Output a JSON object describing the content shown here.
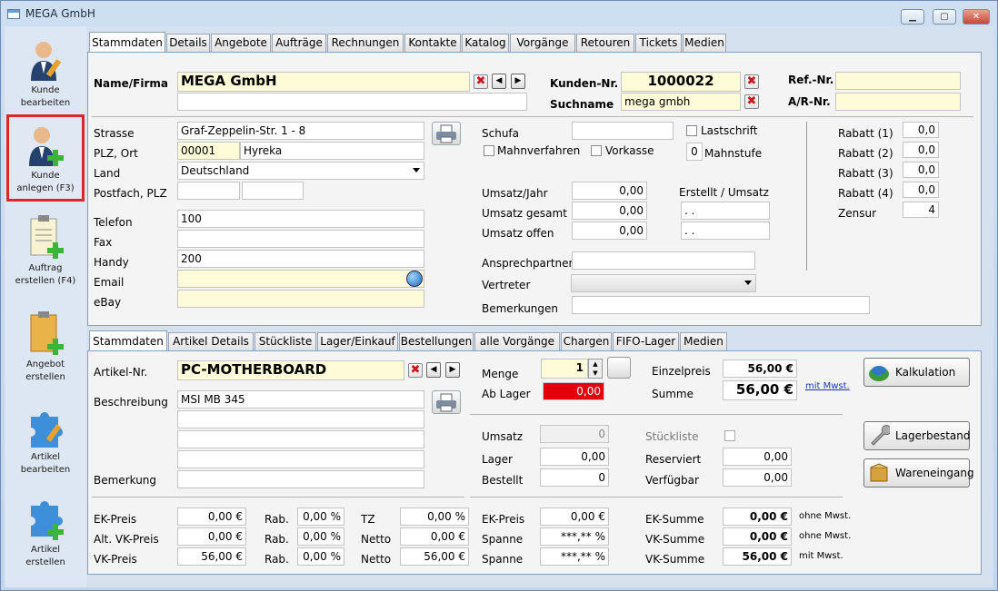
{
  "window": {
    "title": "MEGA GmbH",
    "min": "▁",
    "max": "▢",
    "close": "✕"
  },
  "sidebar": [
    {
      "label": "Kunde bearbeiten"
    },
    {
      "label": "Kunde anlegen (F3)"
    },
    {
      "label": "Auftrag erstellen (F4)"
    },
    {
      "label": "Angebot erstellen"
    },
    {
      "label": "Artikel bearbeiten"
    },
    {
      "label": "Artikel erstellen"
    }
  ],
  "customer_tabs": [
    "Stammdaten",
    "Details",
    "Angebote",
    "Aufträge",
    "Rechnungen",
    "Kontakte",
    "Katalog",
    "Vorgänge",
    "Retouren",
    "Tickets",
    "Medien"
  ],
  "customer": {
    "name_label": "Name/Firma",
    "name": "MEGA GmbH",
    "name2": "",
    "kundennr_label": "Kunden-Nr.",
    "kundennr": "1000022",
    "suchname_label": "Suchname",
    "suchname": "mega gmbh",
    "refnr_label": "Ref.-Nr.",
    "refnr": "",
    "arnr_label": "A/R-Nr.",
    "arnr": "",
    "strasse_label": "Strasse",
    "strasse": "Graf-Zeppelin-Str. 1 - 8",
    "plz_label": "PLZ, Ort",
    "plz": "00001",
    "ort": "Hyreka",
    "land_label": "Land",
    "land": "Deutschland",
    "postfach_label": "Postfach, PLZ",
    "postfach": "",
    "postfach_plz": "",
    "telefon_label": "Telefon",
    "telefon": "100",
    "fax_label": "Fax",
    "fax": "",
    "handy_label": "Handy",
    "handy": "200",
    "email_label": "Email",
    "email": "",
    "ebay_label": "eBay",
    "ebay": "",
    "schufa_label": "Schufa",
    "schufa": "",
    "lastschrift_label": "Lastschrift",
    "mahnverfahren_label": "Mahnverfahren",
    "vorkasse_label": "Vorkasse",
    "mahnstufe_value": "0",
    "mahnstufe_label": "Mahnstufe",
    "umsatz_jahr_label": "Umsatz/Jahr",
    "umsatz_jahr": "0,00",
    "umsatz_gesamt_label": "Umsatz gesamt",
    "umsatz_gesamt": "0,00",
    "umsatz_offen_label": "Umsatz offen",
    "umsatz_offen": "0,00",
    "erstellt_label": "Erstellt / Umsatz",
    "erstellt_date1": ". .",
    "erstellt_date2": ". .",
    "ansprechpartner_label": "Ansprechpartner",
    "ansprechpartner": "",
    "vertreter_label": "Vertreter",
    "vertreter": "",
    "bemerkungen_label": "Bemerkungen",
    "bemerkungen": "",
    "rabatt1_label": "Rabatt (1)",
    "rabatt1": "0,0",
    "rabatt2_label": "Rabatt (2)",
    "rabatt2": "0,0",
    "rabatt3_label": "Rabatt (3)",
    "rabatt3": "0,0",
    "rabatt4_label": "Rabatt (4)",
    "rabatt4": "0,0",
    "zensur_label": "Zensur",
    "zensur": "4"
  },
  "article_tabs": [
    "Stammdaten",
    "Artikel Details",
    "Stückliste",
    "Lager/Einkauf",
    "Bestellungen",
    "alle Vorgänge",
    "Chargen",
    "FIFO-Lager",
    "Medien"
  ],
  "article": {
    "artnr_label": "Artikel-Nr.",
    "artnr": "PC-MOTHERBOARD",
    "beschreibung_label": "Beschreibung",
    "beschreibung": "MSI MB 345",
    "bemerkung_label": "Bemerkung",
    "menge_label": "Menge",
    "menge": "1",
    "ablager_label": "Ab Lager",
    "ablager": "0,00",
    "einzelpreis_label": "Einzelpreis",
    "einzelpreis": "56,00 €",
    "summe_label": "Summe",
    "summe": "56,00 €",
    "mitmwst_link": "mit Mwst.",
    "kalkulation_button": "Kalkulation",
    "lagerbestand_button": "Lagerbestand",
    "wareneingang_button": "Wareneingang",
    "umsatz_label": "Umsatz",
    "umsatz": "0",
    "lager_label": "Lager",
    "lager": "0,00",
    "bestellt_label": "Bestellt",
    "bestellt": "0",
    "stueckliste_label": "Stückliste",
    "reserviert_label": "Reserviert",
    "reserviert": "0,00",
    "verfuegbar_label": "Verfügbar",
    "verfuegbar": "0,00",
    "ekpreis_label": "EK-Preis",
    "ekpreis": "0,00  €",
    "altvk_label": "Alt. VK-Preis",
    "altvk": "0,00  €",
    "vkpreis_label": "VK-Preis",
    "vkpreis": "56,00  €",
    "rab_label": "Rab.",
    "rab1": "0,00 %",
    "rab2": "0,00 %",
    "rab3": "0,00 %",
    "tz_label": "TZ",
    "tz": "0,00 %",
    "netto_label": "Netto",
    "netto1": "0,00  €",
    "netto2": "56,00  €",
    "ekpreis2_label": "EK-Preis",
    "ekpreis2": "0,00  €",
    "spanne_label": "Spanne",
    "spanne1": "***,** %",
    "spanne2": "***,** %",
    "eksumme_label": "EK-Summe",
    "eksumme": "0,00  €",
    "ohne1": "ohne Mwst.",
    "vksumme_label": "VK-Summe",
    "vksumme1": "0,00  €",
    "ohne2": "ohne Mwst.",
    "vksumme2": "56,00  €",
    "mit": "mit Mwst."
  }
}
